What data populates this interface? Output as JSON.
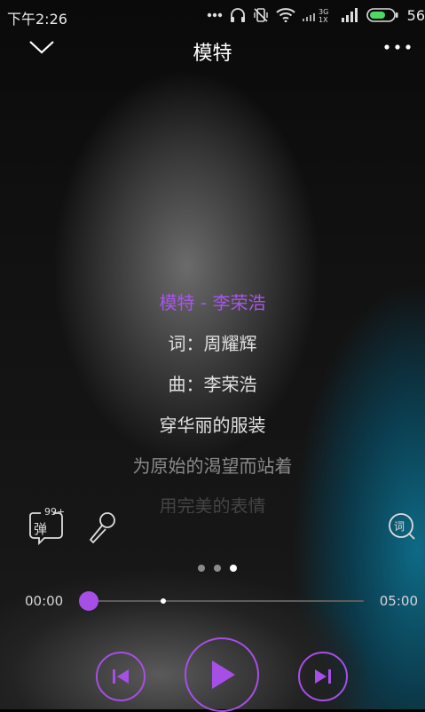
{
  "status_bar": {
    "time": "下午2:26",
    "network_label": "3G\n1X",
    "battery_text": "56"
  },
  "header": {
    "title": "模特"
  },
  "lyrics": {
    "lines": [
      "模特 - 李荣浩",
      "词：周耀辉",
      "曲：李荣浩",
      "穿华丽的服装",
      "为原始的渴望而站着",
      "用完美的表情"
    ],
    "current_index": 0
  },
  "tools": {
    "danmu_badge": "99+",
    "danmu_label": "弹",
    "lyric_button_label": "词"
  },
  "pager": {
    "count": 3,
    "active_index": 2
  },
  "player": {
    "current_time": "00:00",
    "total_time": "05:00",
    "progress_fraction": 0.0,
    "buffer_fraction": 0.27,
    "accent_color": "#a64fe6"
  },
  "icons": {
    "back": "chevron-down-icon",
    "more": "more-dots-icon",
    "mic": "microphone-icon",
    "prev": "previous-track-icon",
    "play": "play-icon",
    "next": "next-track-icon"
  }
}
